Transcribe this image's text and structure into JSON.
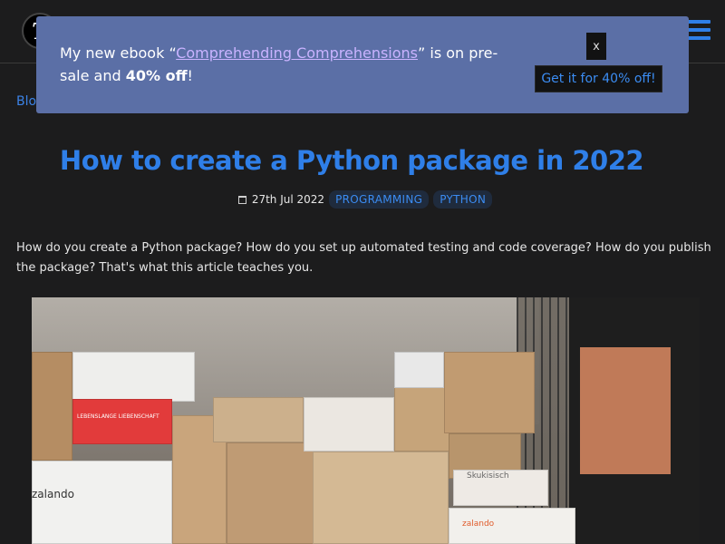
{
  "header": {
    "logo_text": "T",
    "menu_icon": "hamburger-menu-icon",
    "accent_color": "#2f7fe8"
  },
  "breadcrumb": {
    "label": "Blog"
  },
  "promo": {
    "text_before": "My new ebook “",
    "link_text": "Comprehending Comprehensions",
    "text_after": "” is on pre-sale and ",
    "discount": "40% off",
    "text_end": "!",
    "close_label": "x",
    "cta_label": "Get it for 40% off!",
    "background_color": "#5b6fa6"
  },
  "article": {
    "title": "How to create a Python package in 2022",
    "date": "27th Jul 2022",
    "tags": [
      "PROGRAMMING",
      "PYTHON"
    ],
    "intro": "How do you create a Python package? How do you set up automated testing and code coverage? How do you publish the package? That's what this article teaches you."
  },
  "hero": {
    "alt_description_icon": "hero-image-icon",
    "box_labels": [
      "LEBENSLANGE LIEBENSCHAFT",
      "zalando",
      "zalando",
      "Skukisisch"
    ]
  }
}
